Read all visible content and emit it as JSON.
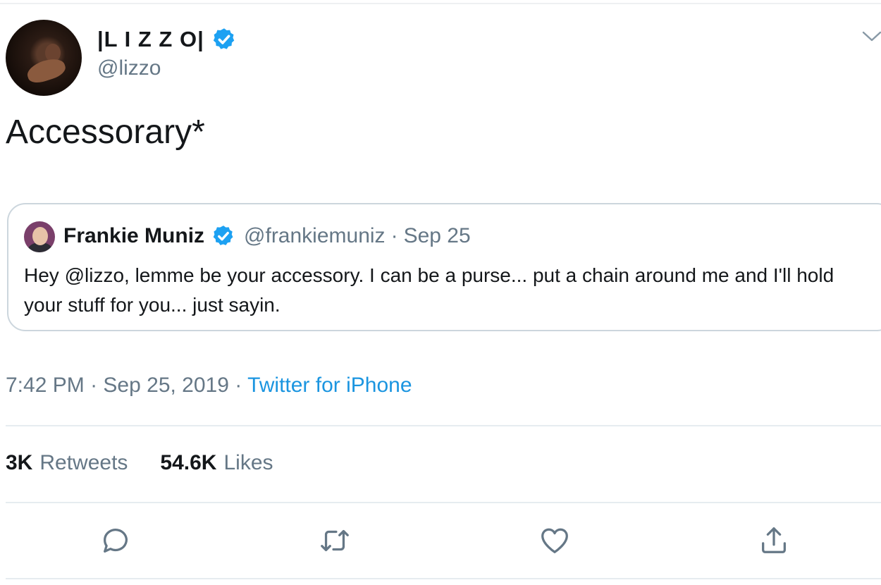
{
  "tweet": {
    "display_name": "|L I Z Z O|",
    "handle": "@lizzo",
    "text": "Accessorary*",
    "time": "7:42 PM",
    "date": "Sep 25, 2019",
    "source": "Twitter for iPhone",
    "separator": "·"
  },
  "quoted": {
    "display_name": "Frankie Muniz",
    "handle": "@frankiemuniz",
    "separator": "·",
    "date": "Sep 25",
    "text": "Hey @lizzo, lemme be your accessory. I can be a purse... put a chain around me and I'll hold your stuff for you... just sayin."
  },
  "stats": {
    "retweets_count": "3K",
    "retweets_label": "Retweets",
    "likes_count": "54.6K",
    "likes_label": "Likes"
  },
  "icons": {
    "verified": "verified-badge-icon",
    "menu": "chevron-down-icon",
    "reply": "reply-icon",
    "retweet": "retweet-icon",
    "like": "heart-icon",
    "share": "share-icon"
  },
  "colors": {
    "accent": "#1da1f2",
    "link": "#1b95e0",
    "secondary_text": "#657786",
    "border": "#ccd6dd"
  }
}
